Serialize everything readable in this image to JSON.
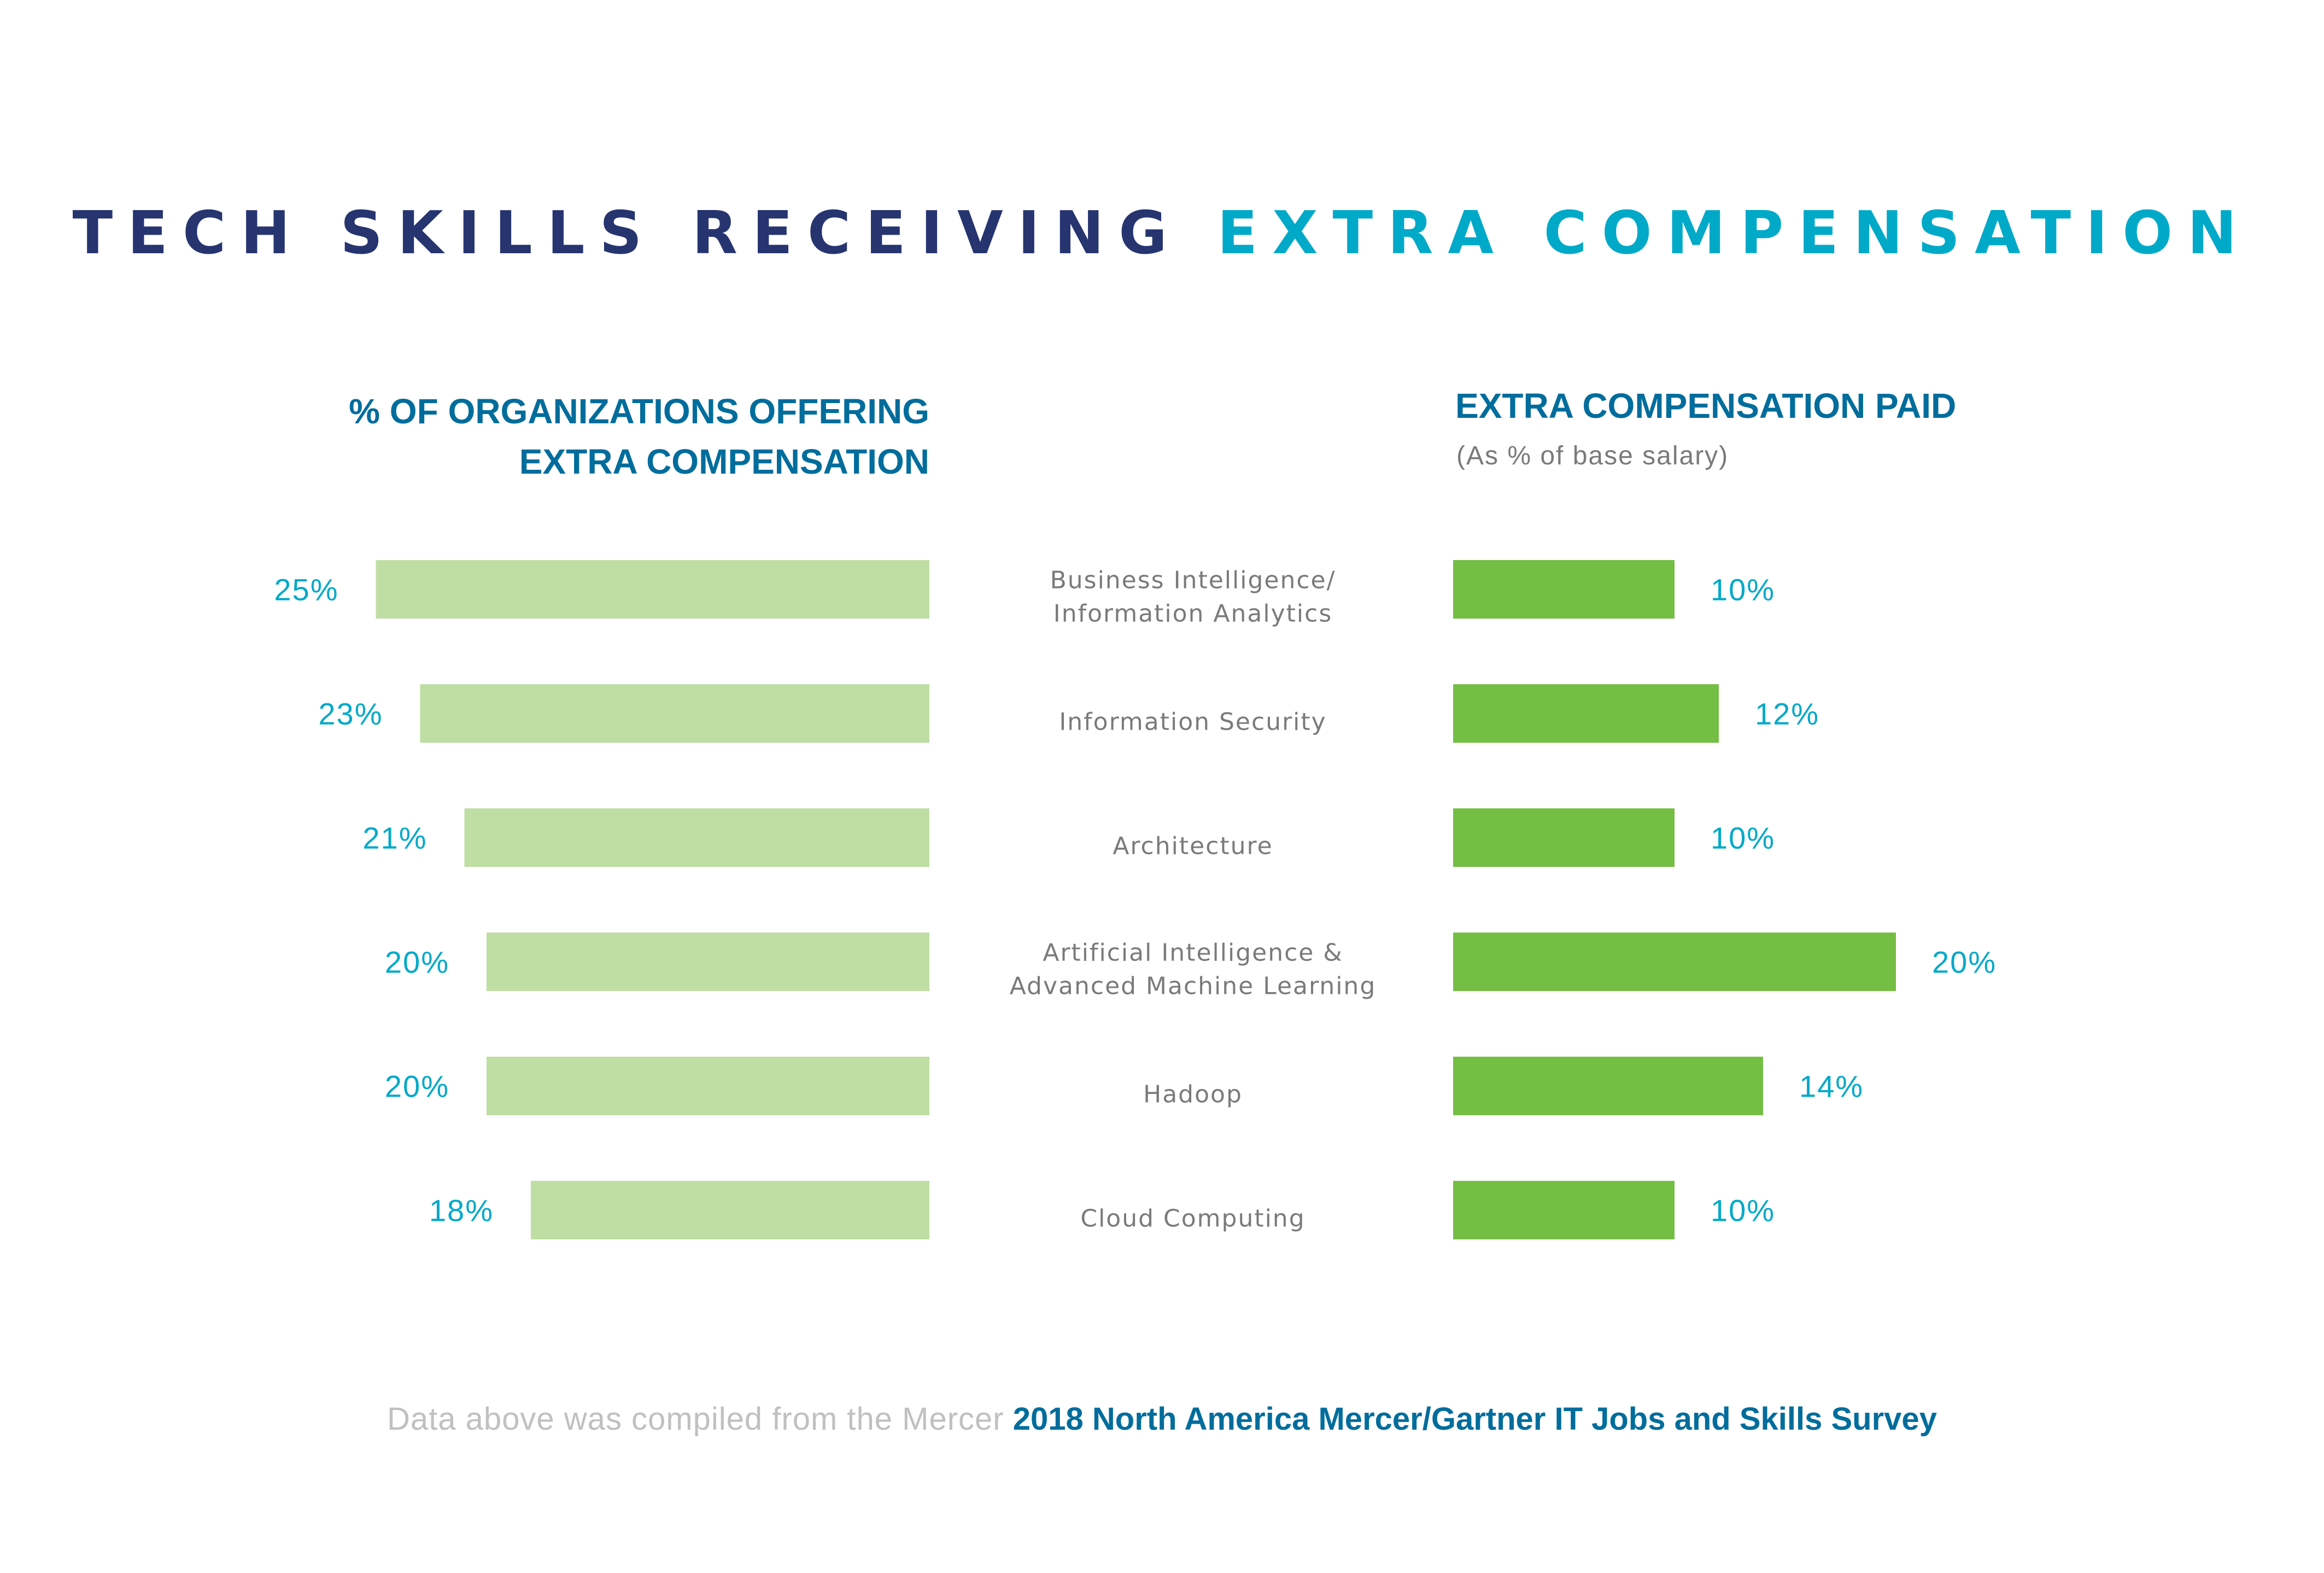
{
  "title": {
    "part1": "TECH SKILLS RECEIVING",
    "part2": "EXTRA COMPENSATION"
  },
  "colors": {
    "title_dark": "#263470",
    "title_accent": "#00a9c8",
    "header": "#006d9c",
    "bar_left": "#bfdea3",
    "bar_right": "#74be44",
    "value_label": "#00a9c8",
    "category_label": "#7a7a7a"
  },
  "left_header": {
    "line1": "% OF ORGANIZATIONS OFFERING",
    "line2": "EXTRA COMPENSATION"
  },
  "right_header": {
    "title": "EXTRA COMPENSATION PAID",
    "subtitle": "(As % of base salary)"
  },
  "footer": {
    "prefix": "Data above was compiled from the Mercer",
    "source": "2018 North America Mercer/Gartner IT Jobs and Skills Survey"
  },
  "chart_data": {
    "type": "bar",
    "orientation": "horizontal-butterfly",
    "title": "TECH SKILLS RECEIVING EXTRA COMPENSATION",
    "categories": [
      [
        "Business Intelligence/",
        "Information Analytics"
      ],
      [
        "Information Security"
      ],
      [
        "Architecture"
      ],
      [
        "Artificial Intelligence &",
        "Advanced Machine Learning"
      ],
      [
        "Hadoop"
      ],
      [
        "Cloud Computing"
      ]
    ],
    "series": [
      {
        "name": "% OF ORGANIZATIONS OFFERING EXTRA COMPENSATION",
        "side": "left",
        "values": [
          25,
          23,
          21,
          20,
          20,
          18
        ],
        "labels": [
          "25%",
          "23%",
          "21%",
          "20%",
          "20%",
          "18%"
        ]
      },
      {
        "name": "EXTRA COMPENSATION PAID (As % of base salary)",
        "side": "right",
        "values": [
          10,
          12,
          10,
          20,
          14,
          10
        ],
        "labels": [
          "10%",
          "12%",
          "10%",
          "20%",
          "14%",
          "10%"
        ]
      }
    ],
    "xlabel": "",
    "ylabel": "",
    "unit": "%",
    "grid": false,
    "legend": "none"
  }
}
